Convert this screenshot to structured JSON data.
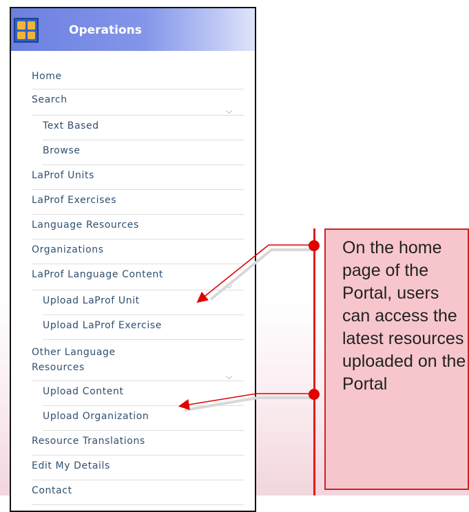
{
  "panel": {
    "title": "Operations",
    "icon": "operations-grid-icon"
  },
  "menu": {
    "items": [
      {
        "label": "Home",
        "sub": false,
        "chevron": false
      },
      {
        "label": "Search",
        "sub": false,
        "chevron": true
      },
      {
        "label": "Text Based",
        "sub": true,
        "chevron": false
      },
      {
        "label": "Browse",
        "sub": true,
        "chevron": false
      },
      {
        "label": "LaProf Units",
        "sub": false,
        "chevron": false
      },
      {
        "label": "LaProf Exercises",
        "sub": false,
        "chevron": false
      },
      {
        "label": "Language Resources",
        "sub": false,
        "chevron": false
      },
      {
        "label": "Organizations",
        "sub": false,
        "chevron": false
      },
      {
        "label": "LaProf Language Content",
        "sub": false,
        "chevron": true
      },
      {
        "label": "Upload LaProf Unit",
        "sub": true,
        "chevron": false
      },
      {
        "label": "Upload LaProf Exercise",
        "sub": true,
        "chevron": false
      },
      {
        "label": "Other Language Resources",
        "sub": false,
        "chevron": true
      },
      {
        "label": "Upload Content",
        "sub": true,
        "chevron": false
      },
      {
        "label": "Upload Organization",
        "sub": true,
        "chevron": false
      },
      {
        "label": "Resource Translations",
        "sub": false,
        "chevron": false
      },
      {
        "label": "Edit My Details",
        "sub": false,
        "chevron": false
      },
      {
        "label": "Contact",
        "sub": false,
        "chevron": false
      }
    ]
  },
  "callout": {
    "text": "On the home page of the Portal, users can access the latest resources uploaded on the Portal"
  },
  "colors": {
    "accent": "#6b7fe0",
    "menu_text": "#2f4f6f",
    "callout_bg": "#f7c6cc",
    "callout_border": "#cc2222",
    "arrow": "#e00000"
  }
}
